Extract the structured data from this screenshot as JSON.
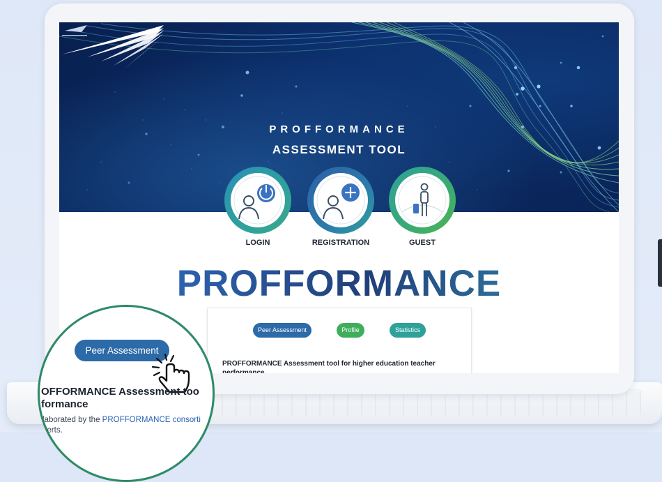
{
  "hero": {
    "brand_name": "PROFFORMANCE",
    "brand_subtitle": "ASSESSMENT TOOL"
  },
  "actions": {
    "login": "LOGIN",
    "registration": "REGISTRATION",
    "guest": "GUEST"
  },
  "main": {
    "title": "PROFFORMANCE"
  },
  "card": {
    "pills": [
      "Peer Assessment",
      "Profile",
      "Statistics"
    ],
    "description": "PROFFORMANCE Assessment tool for higher education teacher performance"
  },
  "magnifier": {
    "button_label": "Peer Assessment",
    "title_line1": "OFFORMANCE Assessment too",
    "title_line2": "formance",
    "desc_prefix": "laborated by the ",
    "desc_link": "PROFFORMANCE consorti",
    "desc_line2": "perts."
  },
  "colors": {
    "hero_dark": "#08204f",
    "ring_teal": "#2ea29a",
    "ring_green": "#3fae5b",
    "pill_blue": "#2c6aa8",
    "pill_green": "#3fae5b",
    "pill_teal": "#2ea29a",
    "magnifier_border": "#2e8a67"
  },
  "icons": [
    "login-power-user-icon",
    "registration-add-user-icon",
    "guest-traveler-icon",
    "pointer-hand-icon",
    "profformance-wing-logo"
  ]
}
